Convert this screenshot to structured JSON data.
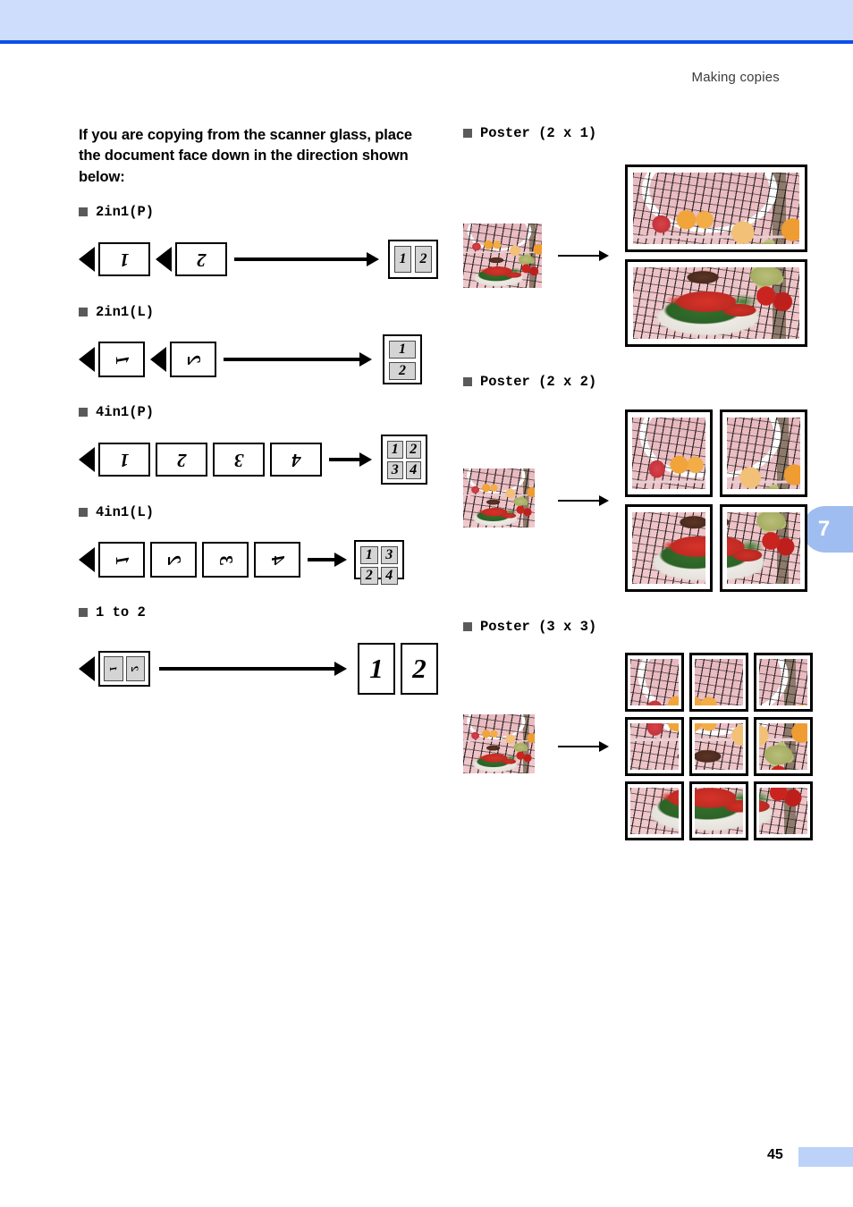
{
  "header": {
    "running_title": "Making copies",
    "band_color": "#cdddfb",
    "rule_color": "#0d4fe8"
  },
  "chapter_tab": {
    "number": "7",
    "color": "#9fbdf0"
  },
  "footer": {
    "page_number": "45",
    "block_color": "#bcd2f8"
  },
  "left_column": {
    "intro": "If you are copying from the scanner glass, place the document face down in the direction shown below:",
    "sections": [
      {
        "label": "2in1(P)",
        "input_pages": [
          "1",
          "2"
        ],
        "input_orientation": "landscape",
        "output": {
          "layout": "2-across",
          "cells": [
            "1",
            "2"
          ]
        }
      },
      {
        "label": "2in1(L)",
        "input_pages": [
          "1",
          "2"
        ],
        "input_orientation": "portrait",
        "output": {
          "layout": "2-down",
          "cells": [
            "1",
            "2"
          ]
        }
      },
      {
        "label": "4in1(P)",
        "input_pages": [
          "1",
          "2",
          "3",
          "4"
        ],
        "input_orientation": "landscape",
        "output": {
          "layout": "2x2",
          "cells": [
            "1",
            "2",
            "3",
            "4"
          ]
        }
      },
      {
        "label": "4in1(L)",
        "input_pages": [
          "1",
          "2",
          "3",
          "4"
        ],
        "input_orientation": "portrait",
        "output": {
          "layout": "2x2",
          "cells": [
            "1",
            "3",
            "2",
            "4"
          ]
        }
      },
      {
        "label": "1 to 2",
        "input_pages": [
          "1",
          "2"
        ],
        "input_orientation": "combined",
        "output": {
          "layout": "2-pages",
          "cells": [
            "1",
            "2"
          ]
        }
      }
    ]
  },
  "right_column": {
    "sections": [
      {
        "label": "Poster (2 x 1)",
        "rows": 2,
        "cols": 1
      },
      {
        "label": "Poster (2 x 2)",
        "rows": 2,
        "cols": 2
      },
      {
        "label": "Poster (3 x 3)",
        "rows": 3,
        "cols": 3
      }
    ],
    "source_image_alt": "still life photo: tennis racket, wine glass, oranges, grapes, tomatoes and lobster on greens over pink cloth"
  },
  "icons": {
    "triangle_left": "triangle-left-icon",
    "arrow_right": "arrow-right-icon",
    "bullet_square": "bullet-square-icon"
  }
}
